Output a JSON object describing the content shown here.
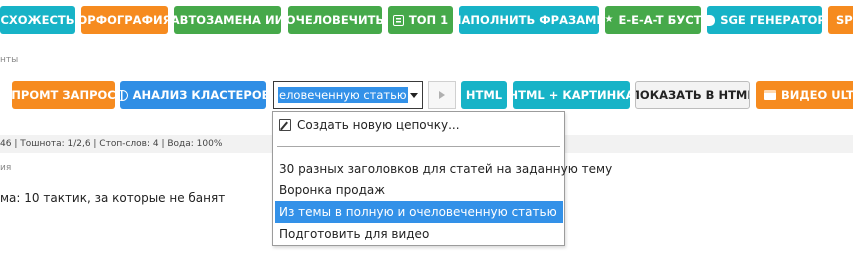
{
  "toolbar_row1": [
    {
      "key": "similarity",
      "label": "СХОЖЕСТЬ",
      "color": "#17b3c7"
    },
    {
      "key": "spelling",
      "label": "ОРФОГРАФИЯ",
      "color": "#f68b1f"
    },
    {
      "key": "ai_replace",
      "label": "АВТОЗАМЕНА ИИ",
      "color": "#46a94a"
    },
    {
      "key": "humanize",
      "label": "ОЧЕЛОВЕЧИТЬ",
      "color": "#46a94a"
    },
    {
      "key": "top1",
      "label": "ТОП 1",
      "color": "#46a94a",
      "icon": "list-icon"
    },
    {
      "key": "fill_phrases",
      "label": "НАПОЛНИТЬ ФРАЗАМИ",
      "color": "#17b3c7"
    },
    {
      "key": "eeat",
      "label": "E-E-A-T БУСТ",
      "color": "#46a94a",
      "icon": "star-icon"
    },
    {
      "key": "sge",
      "label": "SGE ГЕНЕРАТОР",
      "color": "#17b3c7",
      "icon": "robot-icon"
    },
    {
      "key": "spin",
      "label": "SPI",
      "color": "#f68b1f"
    }
  ],
  "faded_labels": {
    "row1_caption": "нты",
    "row3_caption": "ия"
  },
  "toolbar_row2": {
    "prompt_request": {
      "label": "ПРОМТ ЗАПРОС",
      "color": "#f68b1f"
    },
    "cluster_analysis": {
      "label": "АНАЛИЗ КЛАСТЕРОВ",
      "color": "#2f8ee5",
      "icon": "brain-icon"
    },
    "chain_select": {
      "value": "еловеченную статью"
    },
    "html": {
      "label": "HTML",
      "color": "#17b3c7"
    },
    "html_image": {
      "label": "HTML + КАРТИНКА",
      "color": "#17b3c7"
    },
    "show_html": {
      "label": "ПОКАЗАТЬ В HTML"
    },
    "video_ultra": {
      "label": "ВИДЕО ULTRA",
      "color": "#f68b1f",
      "icon": "film-icon"
    }
  },
  "stats_line": "46 | Тошнота: 1/2,6 | Стоп-слов: 4 | Вода: 100%",
  "topic_text": "ма: 10 тактик, за которые не банят",
  "dropdown": {
    "create_item": "Создать новую цепочку...",
    "items": [
      "30 разных заголовков для статей на заданную тему",
      "Воронка продаж",
      "Из темы в полную и очеловеченную статью",
      "Подготовить для видео"
    ],
    "selected_index": 2
  }
}
